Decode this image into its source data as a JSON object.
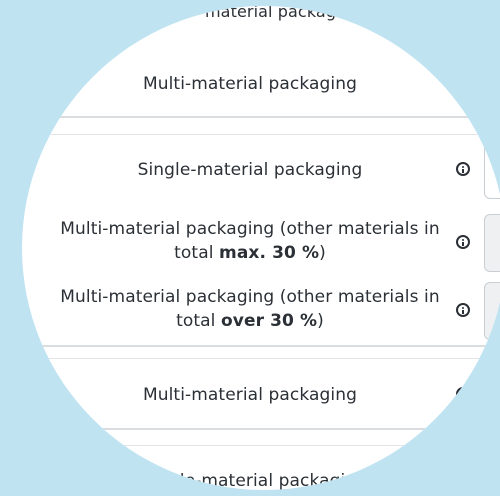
{
  "rows": {
    "top_cut_label": "material packaging",
    "row1_label": "Multi-material packaging",
    "row2_label": "Single-material packaging",
    "row3_label_a": "Multi-material packaging (other materials in",
    "row3_label_b_prefix": "total ",
    "row3_label_b_bold": "max. 30 %",
    "row3_label_b_suffix": ")",
    "row4_label_a": "Multi-material packaging (other materials in",
    "row4_label_b_prefix": "total ",
    "row4_label_b_bold": "over 30 %",
    "row4_label_b_suffix": ")",
    "row5_label": "Multi-material packaging",
    "row6_label": "ngle-material packaging"
  },
  "colors": {
    "background": "#bfe3f1",
    "panel": "#ffffff",
    "text": "#2b3036",
    "divider": "#d9dde0"
  },
  "icons": [
    "info-icon"
  ]
}
